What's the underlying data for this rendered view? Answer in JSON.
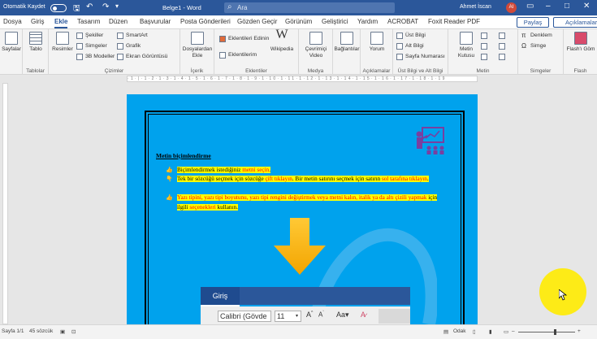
{
  "titlebar": {
    "autosave_label": "Otomatik Kaydet",
    "doc_title": "Belge1 - Word",
    "search_placeholder": "Ara",
    "user_name": "Ahmet İscan",
    "user_initials": "AI",
    "bg_color": "#2b579a"
  },
  "tabs": [
    "Dosya",
    "Giriş",
    "Ekle",
    "Tasarım",
    "Düzen",
    "Başvurular",
    "Posta Gönderileri",
    "Gözden Geçir",
    "Görünüm",
    "Geliştirici",
    "Yardım",
    "ACROBAT",
    "Foxit Reader PDF"
  ],
  "active_tab": "Ekle",
  "share_label": "Paylaş",
  "comments_label": "Açıklamalar",
  "ribbon": {
    "pages": {
      "label": "Sayfalar",
      "group": ""
    },
    "tables": {
      "label": "Tablo",
      "group": "Tablolar"
    },
    "illustrations": {
      "pictures": "Resimler",
      "shapes": "Şekiller",
      "icons": "Simgeler",
      "models": "3B Modeller",
      "smartart": "SmartArt",
      "chart": "Grafik",
      "screenshot": "Ekran Görüntüsü",
      "group": "Çizimler"
    },
    "content": {
      "label": "Dosyalardan Ekle",
      "group": "İçerik"
    },
    "addins": {
      "get": "Eklentileri Edinin",
      "my": "Eklentilerim",
      "wikipedia": "Wikipedia",
      "group": "Eklentiler"
    },
    "media": {
      "label": "Çevrimiçi Video",
      "group": "Medya"
    },
    "links": {
      "label": "Bağlantılar"
    },
    "comments": {
      "label": "Yorum",
      "group": "Açıklamalar"
    },
    "header_footer": {
      "header": "Üst Bilgi",
      "footer": "Alt Bilgi",
      "page_number": "Sayfa Numarası",
      "group": "Üst Bilgi ve Alt Bilgi"
    },
    "text": {
      "textbox": "Metin Kutusu",
      "group": "Metin"
    },
    "symbols": {
      "equation": "Denklem",
      "symbol": "Simge",
      "group": "Simgeler"
    },
    "flash": {
      "label": "Flash'ı Göm",
      "group": "Flash"
    }
  },
  "document": {
    "heading": "Metin biçimlendirme",
    "bullets": [
      [
        {
          "t": "Biçimlendirmek istediğiniz ",
          "red": false
        },
        {
          "t": "metni seçin",
          "red": true
        },
        {
          "t": ".",
          "red": false
        }
      ],
      [
        {
          "t": "Tek bir sözcüğü seçmek için sözcüğe ",
          "red": false
        },
        {
          "t": "çift tıklayın",
          "red": true
        },
        {
          "t": ". Bir metin satırını seçmek için satırın ",
          "red": false
        },
        {
          "t": "sol tarafına tıklayın",
          "red": true
        },
        {
          "t": ".",
          "red": false
        }
      ],
      [
        {
          "t": "Yazı tipini, yazı tipi boyutunu, yazı tipi rengini değiştirmek veya metni kalın, italik ya da altı çizili yapmak",
          "red": true
        },
        {
          "t": " için ilgili ",
          "red": false
        },
        {
          "t": "seçenekleri",
          "red": true
        },
        {
          "t": " kullanın.",
          "red": false
        }
      ]
    ],
    "page_color": "#00a2ed"
  },
  "inset": {
    "tab": "Giriş",
    "font": "Calibri (Gövde",
    "size": "11"
  },
  "status": {
    "page": "Sayfa 1/1",
    "words": "45 sözcük",
    "focus": "Odak"
  }
}
